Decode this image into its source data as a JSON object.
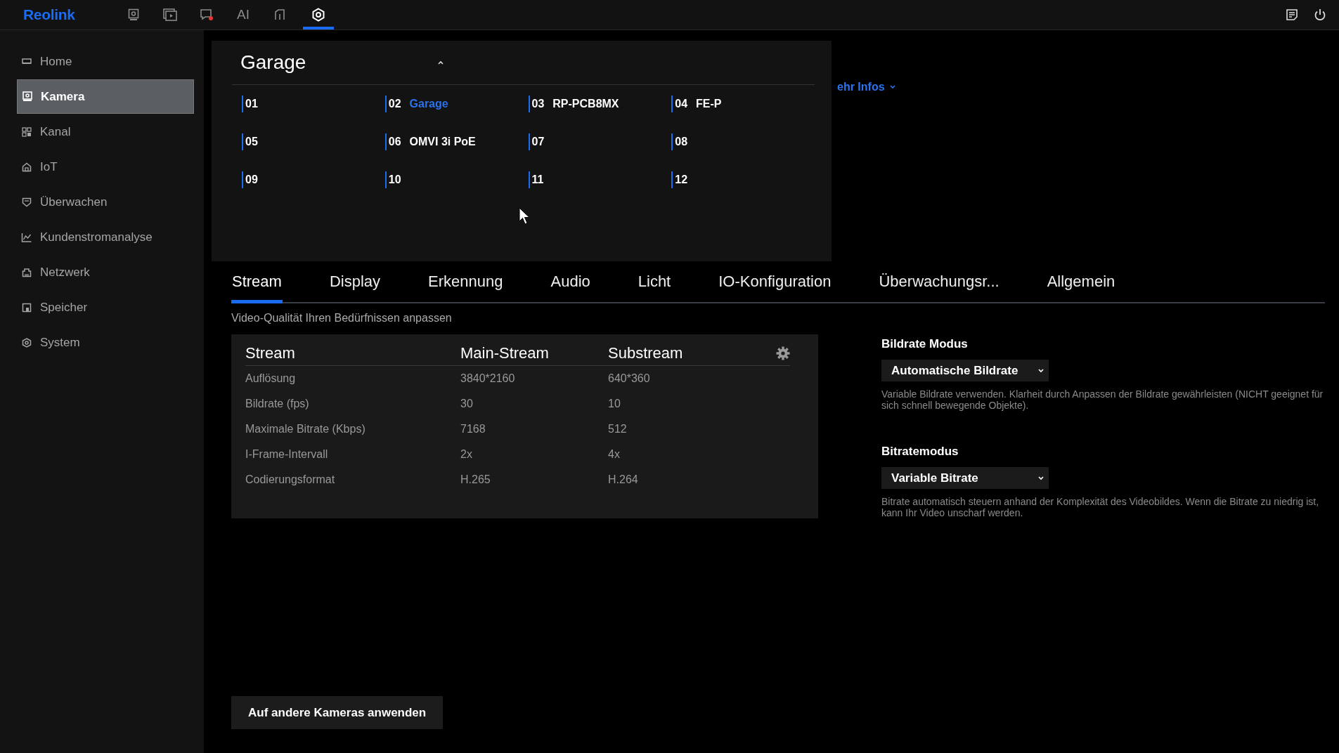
{
  "top_bar": {
    "logo": "Reolink",
    "nav": [
      {
        "kind": "camera",
        "selected": false
      },
      {
        "kind": "playback",
        "selected": false
      },
      {
        "kind": "alert",
        "selected": false
      },
      {
        "kind": "text",
        "label": "AI",
        "selected": false
      },
      {
        "kind": "file",
        "selected": false
      },
      {
        "kind": "settings",
        "selected": true
      }
    ],
    "actions": [
      {
        "kind": "notes"
      },
      {
        "kind": "power"
      }
    ]
  },
  "sidebar": {
    "items": [
      {
        "kind": "home",
        "label": "Home",
        "selected": false
      },
      {
        "kind": "camera",
        "label": "Kamera",
        "selected": true
      },
      {
        "kind": "grid",
        "label": "Kanal",
        "selected": false
      },
      {
        "kind": "house",
        "label": "IoT",
        "selected": false
      },
      {
        "kind": "shield",
        "label": "Überwachen",
        "selected": false
      },
      {
        "kind": "chart",
        "label": "Kundenstromanalyse",
        "selected": false
      },
      {
        "kind": "network",
        "label": "Netzwerk",
        "selected": false
      },
      {
        "kind": "storage",
        "label": "Speicher",
        "selected": false
      },
      {
        "kind": "system",
        "label": "System",
        "selected": false
      }
    ]
  },
  "more_info_link": "ehr Infos",
  "camera_selector": {
    "title": "Garage",
    "expanded": true,
    "channels": [
      {
        "number": "01",
        "selected": false
      },
      {
        "number": "02",
        "name": "Garage",
        "selected": true
      },
      {
        "number": "03",
        "name": "RP-PCB8MX",
        "selected": false
      },
      {
        "number": "04",
        "name": "FE-P",
        "selected": false
      },
      {
        "number": "05",
        "selected": false
      },
      {
        "number": "06",
        "name": "OMVI 3i PoE",
        "selected": false
      },
      {
        "number": "07",
        "selected": false
      },
      {
        "number": "08",
        "selected": false
      },
      {
        "number": "09",
        "selected": false
      },
      {
        "number": "10",
        "selected": false
      },
      {
        "number": "11",
        "selected": false
      },
      {
        "number": "12",
        "selected": false
      }
    ]
  },
  "tabs": [
    {
      "label": "Stream",
      "selected": true
    },
    {
      "label": "Display",
      "selected": false
    },
    {
      "label": "Erkennung",
      "selected": false
    },
    {
      "label": "Audio",
      "selected": false
    },
    {
      "label": "Licht",
      "selected": false
    },
    {
      "label": "IO-Konfiguration",
      "selected": false
    },
    {
      "label": "Überwachungsr...",
      "selected": false
    },
    {
      "label": "Allgemein",
      "selected": false
    }
  ],
  "subtitle": "Video-Qualität Ihren Bedürfnissen anpassen",
  "stream_table": {
    "columns": [
      "Stream",
      "Main-Stream",
      "Substream"
    ],
    "rows": [
      [
        "Auflösung",
        "3840*2160",
        "640*360"
      ],
      [
        "Bildrate  (fps)",
        "30",
        "10"
      ],
      [
        "Maximale Bitrate (Kbps)",
        "7168",
        "512"
      ],
      [
        "I-Frame-Intervall",
        "2x",
        "4x"
      ],
      [
        "Codierungsformat",
        "H.265",
        "H.264"
      ]
    ]
  },
  "settings": [
    {
      "label": "Bildrate Modus",
      "value": "Automatische Bildrate",
      "description": "Variable Bildrate verwenden. Klarheit durch Anpassen der Bildrate gewährleisten (NICHT geeignet für sich schnell bewegende Objekte)."
    },
    {
      "label": "Bitratemodus",
      "value": "Variable Bitrate",
      "description": "Bitrate automatisch steuern anhand der Komplexität des Videobildes. Wenn die Bitrate zu niedrig ist, kann Ihr Video unscharf werden."
    }
  ],
  "apply_button": "Auf andere Kameras anwenden"
}
